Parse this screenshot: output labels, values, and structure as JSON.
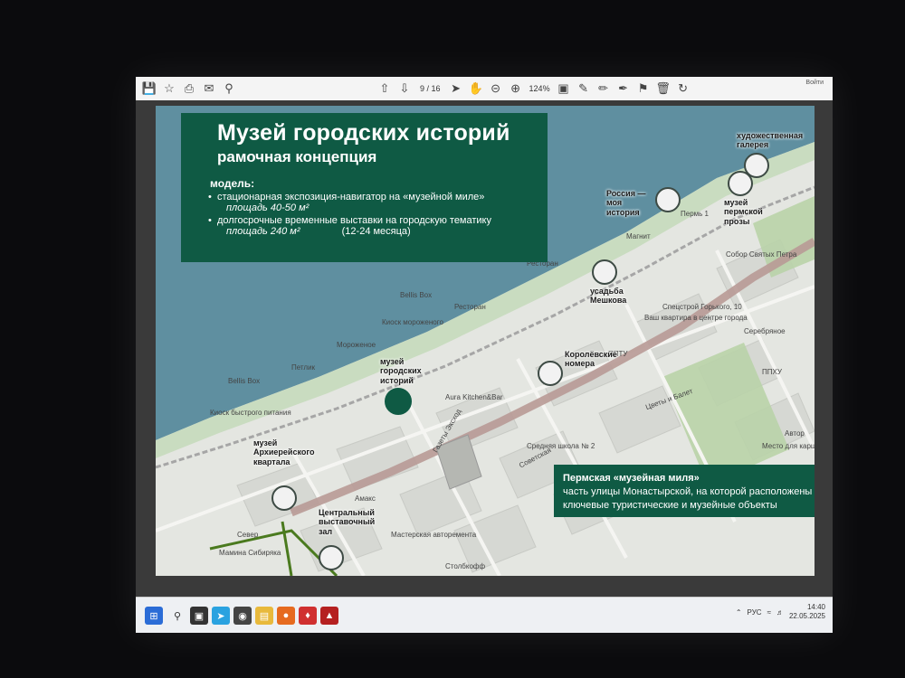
{
  "toolbar": {
    "page_current": "9",
    "page_total": "/ 16",
    "zoom": "124%",
    "account_label": "Войти"
  },
  "slide": {
    "title": "Музей городских историй",
    "subtitle": "рамочная концепция",
    "model_label": "модель:",
    "bullets": [
      {
        "text": "стационарная экспозиция-навигатор на «музейной миле»",
        "sub": "площадь 40-50 м²",
        "extra": ""
      },
      {
        "text": "долгосрочные временные выставки на городскую тематику",
        "sub": "площадь 240 м²",
        "extra": "(12-24 месяца)"
      }
    ],
    "mile_box": {
      "title": "Пермская «музейная миля»",
      "text": "часть улицы Монастырской, на которой расположены ключевые туристические и музейные объекты"
    }
  },
  "map": {
    "pois": [
      {
        "label": "музей городских историй"
      },
      {
        "label": "Россия — моя история"
      },
      {
        "label": "усадьба Мешкова"
      },
      {
        "label": "Королёвские номера"
      },
      {
        "label": "музей Архиерейского квартала"
      },
      {
        "label": "Центральный выставочный зал"
      },
      {
        "label": "музей пермской прозы"
      },
      {
        "label": "художественная галерея"
      }
    ],
    "labels": {
      "bellis1": "Bellis Box",
      "bellis2": "Bellis Box",
      "kiosk1": "Киоск мороженого",
      "kiosk2": "Киоск мороженого",
      "rest1": "Ресторан",
      "rest2": "Ресторан",
      "morozh": "Мороженое",
      "petlik": "Петлик",
      "aura": "Aura Kitchen&Bar",
      "gazety": "Газеты Эксход",
      "sovetskaya": "Советская",
      "school": "Средняя школа № 2",
      "perm1": "Пермь 1",
      "magnit": "Магнит",
      "kiosk3": "Киоск быстрого питания",
      "amaks": "Амакс",
      "master": "Мастерская авторемента",
      "stolb": "Столбкофф",
      "sever": "Север",
      "mamin": "Мамина Сибиряка",
      "spectr": "Спецстрой Горького, 10",
      "vash": "Ваш квартира в центре города",
      "sobor": "Собор Святых Петра",
      "serebr": "Серебряное",
      "pptu": "ППТУ",
      "ppkh": "ППХУ",
      "tsvety": "Цветы и Балет",
      "avtor": "Автор",
      "mesto": "Место для каршеринга"
    }
  },
  "taskbar": {
    "lang": "РУС",
    "time": "14:40",
    "date": "22.05.2025"
  },
  "colors": {
    "accent": "#0f5a44",
    "water": "#5f8fa0",
    "street": "#b89a96"
  }
}
